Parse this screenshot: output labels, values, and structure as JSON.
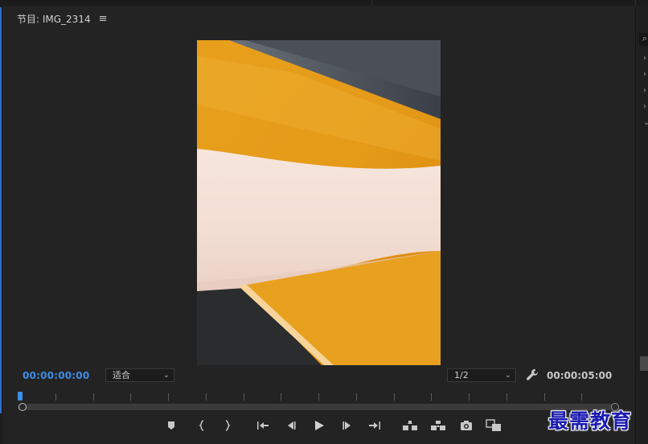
{
  "panel": {
    "title": "节目: IMG_2314",
    "menu_icon": "hamburger-icon"
  },
  "video_frame": {
    "description_icon": "video-preview"
  },
  "controls": {
    "current_timecode": "00:00:00:00",
    "zoom_value": "适合",
    "resolution_value": "1/2",
    "duration_timecode": "00:00:05:00",
    "settings_icon": "wrench-icon"
  },
  "playhead": {
    "position_fraction": 0.0
  },
  "transport_buttons": [
    {
      "name": "add-marker-button",
      "icon": "marker-icon"
    },
    {
      "name": "mark-in-button",
      "icon": "mark-in-icon"
    },
    {
      "name": "mark-out-button",
      "icon": "mark-out-icon"
    },
    {
      "name": "go-to-in-button",
      "icon": "go-to-in-icon"
    },
    {
      "name": "step-back-button",
      "icon": "step-back-icon"
    },
    {
      "name": "play-button",
      "icon": "play-icon"
    },
    {
      "name": "step-forward-button",
      "icon": "step-forward-icon"
    },
    {
      "name": "go-to-out-button",
      "icon": "go-to-out-icon"
    },
    {
      "name": "lift-button",
      "icon": "lift-icon"
    },
    {
      "name": "extract-button",
      "icon": "extract-icon"
    },
    {
      "name": "export-frame-button",
      "icon": "camera-icon"
    },
    {
      "name": "comparison-view-button",
      "icon": "comparison-icon"
    }
  ],
  "watermark": {
    "text": "最需教育"
  },
  "colors": {
    "accent": "#3d8ee6",
    "panel_bg": "#232323",
    "watermark": "#1b1bb0"
  }
}
